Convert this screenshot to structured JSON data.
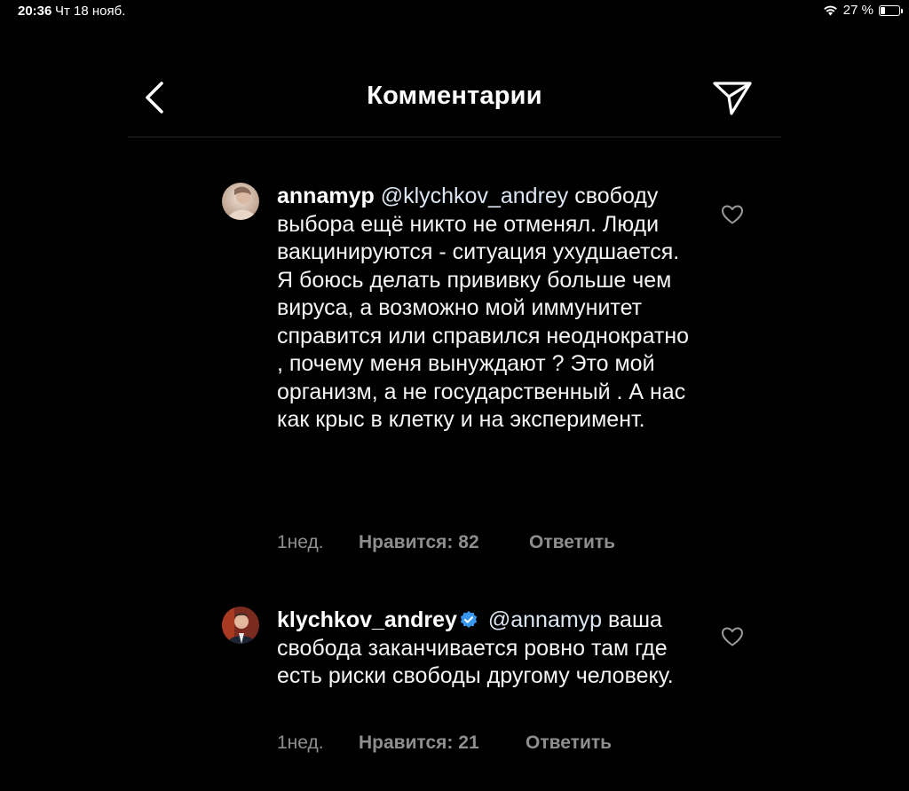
{
  "status_bar": {
    "time": "20:36",
    "date": "Чт 18 нояб.",
    "battery_percent": "27 %",
    "battery_level": 0.27
  },
  "header": {
    "title": "Комментарии"
  },
  "comments": [
    {
      "username": "annamyp",
      "mention": "@klychkov_andrey",
      "text": "свободу выбора ещё никто не отменял. Люди вакцинируются - ситуация ухудшается. Я боюсь делать прививку больше чем вируса, а возможно мой иммунитет справится или справился неоднократно , почему меня вынуждают ? Это мой организм, а не государственный . А нас как крыс в клетку и на эксперимент.",
      "time": "1нед.",
      "likes": "Нравится: 82",
      "reply": "Ответить",
      "verified": false
    },
    {
      "username": "klychkov_andrey",
      "mention": "@annamyp",
      "text": "ваша свобода заканчивается ровно там где есть риски свободы другому человеку.",
      "time": "1нед.",
      "likes": "Нравится: 21",
      "reply": "Ответить",
      "verified": true
    }
  ],
  "colors": {
    "background": "#000000",
    "meta_text": "#8e8e8e",
    "verified_badge": "#3897f0"
  }
}
